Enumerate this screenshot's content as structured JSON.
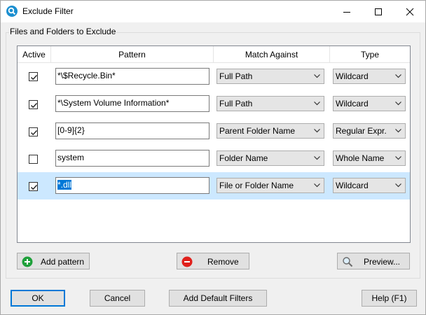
{
  "window": {
    "title": "Exclude Filter"
  },
  "group_label": "Files and Folders to Exclude",
  "columns": {
    "active": "Active",
    "pattern": "Pattern",
    "match_against": "Match Against",
    "type": "Type"
  },
  "rows": [
    {
      "active": true,
      "pattern": "*\\$Recycle.Bin*",
      "pattern_selected": "",
      "match": "Full Path",
      "type": "Wildcard",
      "selected": false
    },
    {
      "active": true,
      "pattern": "*\\System Volume Information*",
      "pattern_selected": "",
      "match": "Full Path",
      "type": "Wildcard",
      "selected": false
    },
    {
      "active": true,
      "pattern": "[0-9]{2}",
      "pattern_selected": "",
      "match": "Parent Folder Name",
      "type": "Regular Expr.",
      "selected": false
    },
    {
      "active": false,
      "pattern": "system",
      "pattern_selected": "",
      "match": "Folder Name",
      "type": "Whole Name",
      "selected": false
    },
    {
      "active": true,
      "pattern": "",
      "pattern_selected": "*.dll",
      "match": "File or Folder Name",
      "type": "Wildcard",
      "selected": true
    }
  ],
  "actions": {
    "add_pattern": "Add pattern",
    "remove": "Remove",
    "preview": "Preview..."
  },
  "footer": {
    "ok": "OK",
    "cancel": "Cancel",
    "add_defaults": "Add Default Filters",
    "help": "Help (F1)"
  },
  "colors": {
    "accent": "#0078d7",
    "selected_row": "#cce8ff",
    "add_icon": "#1ea03a",
    "remove_icon": "#e0201b",
    "app_icon": "#1b8fd0"
  }
}
